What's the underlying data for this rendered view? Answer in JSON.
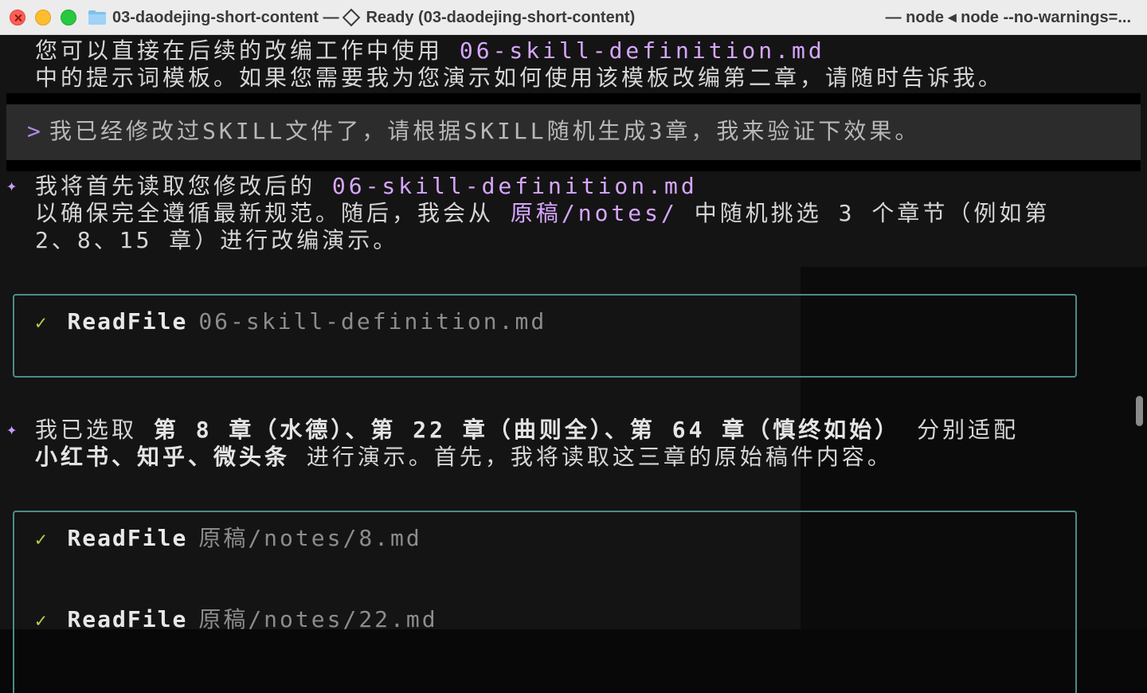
{
  "window": {
    "title": "03-daodejing-short-content —",
    "status": "Ready (03-daodejing-short-content)",
    "title_right": "— node ◂ node --no-warnings=..."
  },
  "terminal": {
    "intro_lines": [
      "您可以直接在后续的改编工作中使用 ",
      "中的提示词模板。如果您需要我为您演示如何使用该模板改编第二章，请随时告诉我。"
    ],
    "intro_file": "06-skill-definition.md",
    "prompt": {
      "caret": ">",
      "text": "我已经修改过SKILL文件了，请根据SKILL随机生成3章，我来验证下效果。"
    },
    "reply1": {
      "line1_text": "我将首先读取您修改后的 ",
      "line1_file": "06-skill-definition.md",
      "line2_pre": "以确保完全遵循最新规范。随后，我会从 ",
      "line2_path": "原稿/notes/",
      "line2_post": " 中随机挑选 3 个章节（例如第",
      "line3": "2、8、15 章）进行改编演示。"
    },
    "tool1": {
      "check": "✓",
      "name": "ReadFile",
      "arg": "06-skill-definition.md"
    },
    "reply2": {
      "line1_pre": "我已选取 ",
      "line1_bold": "第 8 章（水德）、第 22 章（曲则全）、第 64 章（慎终如始）",
      "line1_post": " 分别适配",
      "line2_bold": "小红书、知乎、微头条",
      "line2_post": " 进行演示。首先，我将读取这三章的原始稿件内容。"
    },
    "tool2": [
      {
        "check": "✓",
        "name": "ReadFile",
        "arg": "原稿/notes/8.md"
      },
      {
        "check": "✓",
        "name": "ReadFile",
        "arg": "原稿/notes/22.md"
      }
    ]
  },
  "colors": {
    "accent_purple": "#d7a6ff",
    "tool_border": "#4d8c86",
    "check_green": "#b9c94e"
  },
  "icons": {
    "sparkle": "✦",
    "folder": "folder-icon",
    "diamond": "diamond-icon"
  }
}
